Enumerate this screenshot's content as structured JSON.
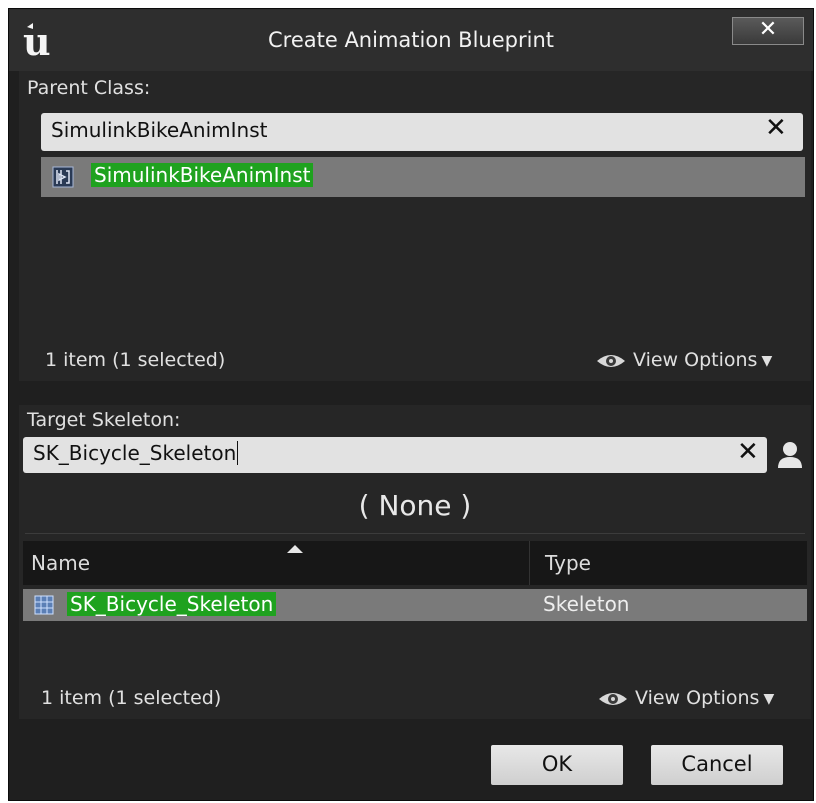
{
  "window": {
    "title": "Create Animation Blueprint",
    "close_label": "✕"
  },
  "parent_class": {
    "label": "Parent Class:",
    "search_value": "SimulinkBikeAnimInst",
    "clear_label": "✕",
    "items": [
      {
        "label": "SimulinkBikeAnimInst",
        "icon": "anim-blueprint-icon",
        "selected": true
      }
    ],
    "status": "1 item (1 selected)",
    "view_options": "View Options"
  },
  "target_skeleton": {
    "label": "Target Skeleton:",
    "search_value": "SK_Bicycle_Skeleton",
    "clear_label": "✕",
    "none_label": "( None )",
    "columns": {
      "name": "Name",
      "type": "Type"
    },
    "rows": [
      {
        "name": "SK_Bicycle_Skeleton",
        "type": "Skeleton",
        "icon": "skeleton-asset-icon",
        "selected": true
      }
    ],
    "status": "1 item (1 selected)",
    "view_options": "View Options"
  },
  "buttons": {
    "ok": "OK",
    "cancel": "Cancel"
  },
  "colors": {
    "highlight": "#1fa21f",
    "selected_row": "#7a7a7a",
    "panel": "#262626"
  }
}
